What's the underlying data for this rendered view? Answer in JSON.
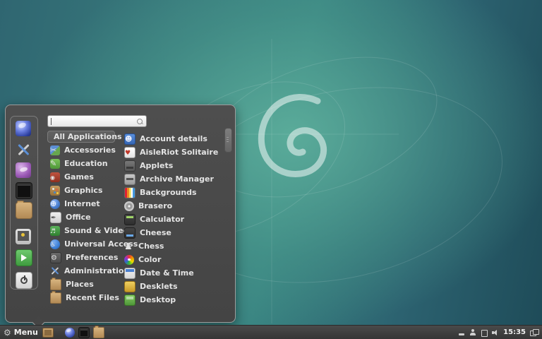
{
  "desktop": {
    "name": "debian-cinnamon-desktop"
  },
  "menu": {
    "search": {
      "placeholder": "",
      "value": ""
    },
    "categories": [
      {
        "label": "All Applications",
        "icon": "all-applications",
        "selected": true
      },
      {
        "label": "Accessories",
        "icon": "accessories"
      },
      {
        "label": "Education",
        "icon": "education"
      },
      {
        "label": "Games",
        "icon": "games"
      },
      {
        "label": "Graphics",
        "icon": "graphics"
      },
      {
        "label": "Internet",
        "icon": "internet"
      },
      {
        "label": "Office",
        "icon": "office"
      },
      {
        "label": "Sound & Video",
        "icon": "sound-video"
      },
      {
        "label": "Universal Access",
        "icon": "universal-access"
      },
      {
        "label": "Preferences",
        "icon": "preferences"
      },
      {
        "label": "Administration",
        "icon": "administration"
      },
      {
        "label": "Places",
        "icon": "places"
      },
      {
        "label": "Recent Files",
        "icon": "recent-files"
      }
    ],
    "applications": [
      {
        "label": "Account details",
        "icon": "account-details"
      },
      {
        "label": "AisleRiot Solitaire",
        "icon": "aisleriot"
      },
      {
        "label": "Applets",
        "icon": "applets"
      },
      {
        "label": "Archive Manager",
        "icon": "archive-manager"
      },
      {
        "label": "Backgrounds",
        "icon": "backgrounds"
      },
      {
        "label": "Brasero",
        "icon": "brasero"
      },
      {
        "label": "Calculator",
        "icon": "calculator"
      },
      {
        "label": "Cheese",
        "icon": "cheese"
      },
      {
        "label": "Chess",
        "icon": "chess"
      },
      {
        "label": "Color",
        "icon": "color"
      },
      {
        "label": "Date & Time",
        "icon": "date-time"
      },
      {
        "label": "Desklets",
        "icon": "desklets"
      },
      {
        "label": "Desktop",
        "icon": "desktop"
      }
    ],
    "sidebar": [
      {
        "name": "web-browser"
      },
      {
        "name": "system-tools"
      },
      {
        "name": "messenger"
      },
      {
        "name": "terminal"
      },
      {
        "name": "file-manager"
      },
      {
        "name": "lock-screen"
      },
      {
        "name": "log-out"
      },
      {
        "name": "shutdown"
      }
    ]
  },
  "panel": {
    "menu_button": {
      "label": "Menu"
    },
    "show_desktop": {
      "name": "show-desktop"
    },
    "launchers": [
      {
        "name": "web-browser"
      },
      {
        "name": "terminal"
      },
      {
        "name": "file-manager"
      }
    ],
    "tray": [
      {
        "name": "removable-media"
      },
      {
        "name": "user-applet"
      },
      {
        "name": "window-applet"
      },
      {
        "name": "volume"
      }
    ],
    "clock": "15:35",
    "notifications": {
      "name": "notifications"
    }
  },
  "colors": {
    "panel_bg": "#3d3d3d",
    "menu_bg": "#4a4a4a",
    "desktop_teal": "#3f8c85",
    "selection_bg": "#5e5e5e",
    "menu_border": "#9c9c9c"
  }
}
